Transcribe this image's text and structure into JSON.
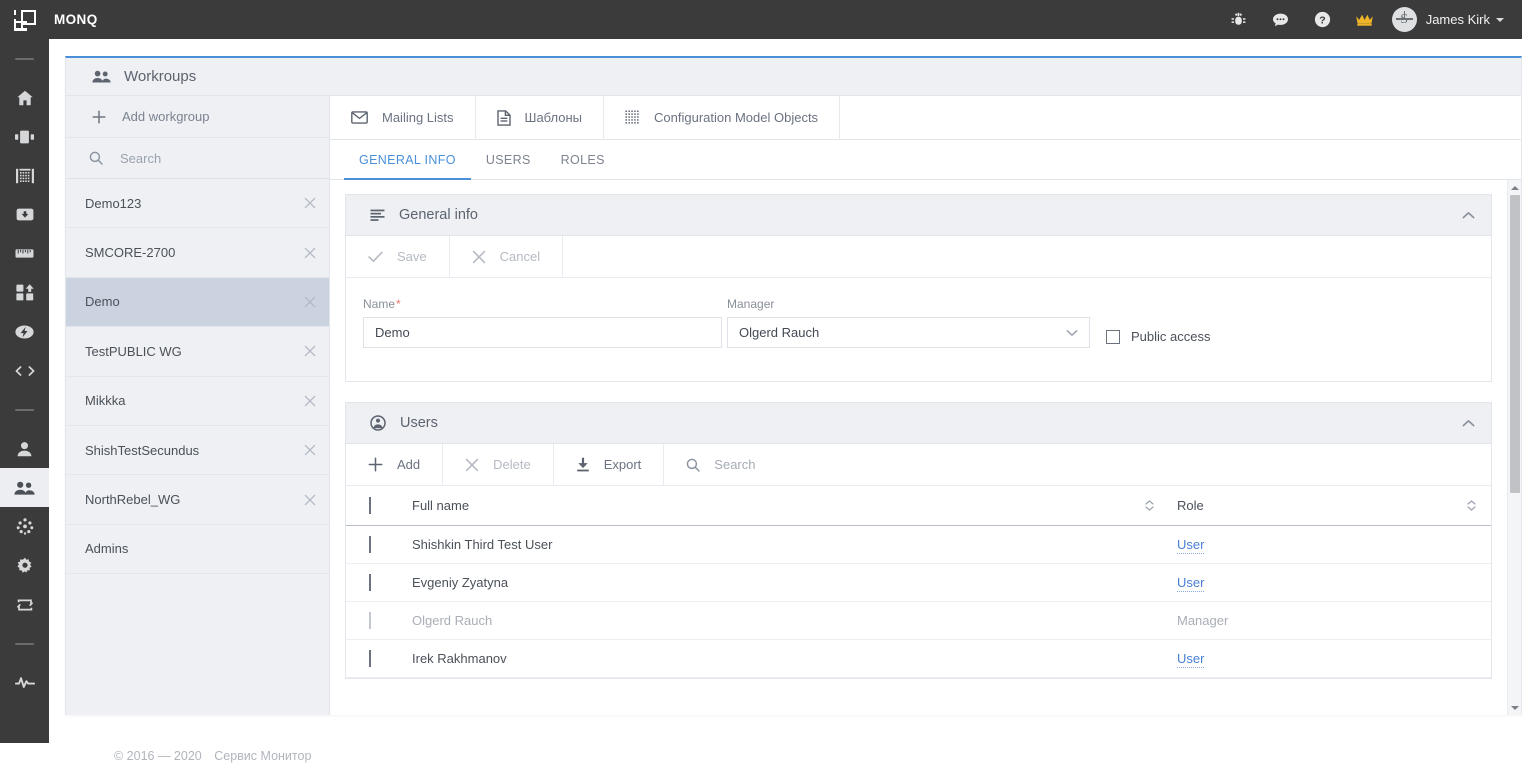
{
  "app": {
    "brand": "MONQ",
    "logo_icon": "monq-logo-icon"
  },
  "topbar": {
    "icons": [
      {
        "name": "bug-icon",
        "label": "Bug report"
      },
      {
        "name": "chat-icon",
        "label": "Chat"
      },
      {
        "name": "help-icon",
        "label": "Help"
      },
      {
        "name": "crown-icon",
        "label": "Premium",
        "color": "#f0b429"
      }
    ],
    "user": {
      "name": "James Kirk",
      "avatar_icon": "user-avatar-icon",
      "caret_icon": "chevron-down-icon"
    }
  },
  "rail": {
    "items": [
      {
        "name": "divider-top",
        "icon": "divider",
        "type": "divider"
      },
      {
        "name": "home",
        "icon": "home-icon",
        "type": "item"
      },
      {
        "name": "panels",
        "icon": "panels-icon",
        "type": "item"
      },
      {
        "name": "grid-table",
        "icon": "grid-table-icon",
        "type": "item"
      },
      {
        "name": "archive",
        "icon": "archive-down-icon",
        "type": "item"
      },
      {
        "name": "ruler",
        "icon": "ruler-icon",
        "type": "item"
      },
      {
        "name": "blocks",
        "icon": "blocks-icon",
        "type": "item"
      },
      {
        "name": "automation",
        "icon": "bolt-icon",
        "type": "item"
      },
      {
        "name": "code",
        "icon": "code-icon",
        "type": "item"
      },
      {
        "name": "divider-mid",
        "icon": "divider",
        "type": "divider"
      },
      {
        "name": "user",
        "icon": "user-icon",
        "type": "item"
      },
      {
        "name": "groups",
        "icon": "groups-icon",
        "type": "item",
        "active": true
      },
      {
        "name": "cluster",
        "icon": "cluster-icon",
        "type": "item"
      },
      {
        "name": "settings",
        "icon": "gear-icon",
        "type": "item"
      },
      {
        "name": "sync",
        "icon": "sync-icon",
        "type": "item"
      },
      {
        "name": "divider-bottom",
        "icon": "divider",
        "type": "divider"
      },
      {
        "name": "pulse",
        "icon": "pulse-icon",
        "type": "item"
      }
    ]
  },
  "page": {
    "title": "Workroups",
    "title_icon": "groups-icon"
  },
  "toolbar": {
    "add_workgroup": {
      "label": "Add workgroup",
      "icon": "plus-icon"
    },
    "buttons": [
      {
        "label": "Mailing Lists",
        "icon": "envelope-icon"
      },
      {
        "label": "Шаблоны",
        "icon": "document-icon"
      },
      {
        "label": "Configuration Model Objects",
        "icon": "dot-grid-icon"
      }
    ]
  },
  "workgroups": {
    "search_placeholder": "Search",
    "search_icon": "search-icon",
    "close_icon": "close-icon",
    "items": [
      {
        "label": "Demo123",
        "closable": true,
        "selected": false
      },
      {
        "label": "SMCORE-2700",
        "closable": true,
        "selected": false
      },
      {
        "label": "Demo",
        "closable": true,
        "selected": true
      },
      {
        "label": "TestPUBLIC WG",
        "closable": true,
        "selected": false
      },
      {
        "label": "Mikkka",
        "closable": true,
        "selected": false
      },
      {
        "label": "ShishTestSecundus",
        "closable": true,
        "selected": false
      },
      {
        "label": "NorthRebel_WG",
        "closable": true,
        "selected": false
      },
      {
        "label": "Admins",
        "closable": false,
        "selected": false
      }
    ]
  },
  "tabs": [
    {
      "label": "GENERAL INFO",
      "active": true
    },
    {
      "label": "USERS",
      "active": false
    },
    {
      "label": "ROLES",
      "active": false
    }
  ],
  "general_info": {
    "title": "General info",
    "title_icon": "list-lines-icon",
    "collapse_icon": "chevron-up-icon",
    "save": {
      "label": "Save",
      "icon": "check-icon",
      "disabled": true
    },
    "cancel": {
      "label": "Cancel",
      "icon": "close-icon",
      "disabled": true
    },
    "name_field": {
      "label": "Name",
      "required_mark": "*",
      "value": "Demo"
    },
    "manager_field": {
      "label": "Manager",
      "value": "Olgerd Rauch",
      "chevron_icon": "chevron-down-icon"
    },
    "public_access": {
      "label": "Public access",
      "checked": false
    }
  },
  "users_panel": {
    "title": "Users",
    "title_icon": "user-circle-icon",
    "collapse_icon": "chevron-up-icon",
    "tools": {
      "add": {
        "label": "Add",
        "icon": "plus-icon",
        "disabled": false
      },
      "delete": {
        "label": "Delete",
        "icon": "close-icon",
        "disabled": true
      },
      "export": {
        "label": "Export",
        "icon": "download-icon",
        "disabled": false
      },
      "search_placeholder": "Search",
      "search_icon": "search-icon"
    },
    "columns": [
      {
        "label": "Full name",
        "sortable": true,
        "sort_icon": "sort-updown-icon"
      },
      {
        "label": "Role",
        "sortable": true,
        "sort_icon": "sort-updown-icon"
      }
    ],
    "rows": [
      {
        "full_name": "Shishkin Third Test User",
        "role": "User",
        "role_is_link": true,
        "disabled": false,
        "checked": false
      },
      {
        "full_name": "Evgeniy Zyatyna",
        "role": "User",
        "role_is_link": true,
        "disabled": false,
        "checked": false
      },
      {
        "full_name": "Olgerd Rauch",
        "role": "Manager",
        "role_is_link": false,
        "disabled": true,
        "checked": false
      },
      {
        "full_name": "Irek Rakhmanov",
        "role": "User",
        "role_is_link": true,
        "disabled": false,
        "checked": false
      }
    ]
  },
  "scrollbar": {
    "up_arrow_icon": "triangle-up-icon",
    "down_arrow_icon": "triangle-down-icon"
  },
  "footer": {
    "copyright": "© 2016 — 2020",
    "product": "Сервис Монитор"
  },
  "colors": {
    "accent": "#4a90d9",
    "topbar_bg": "#3b3b3b",
    "panel_bg": "#eef0f3",
    "selected_row": "#ccd3e0",
    "crown": "#f0b429",
    "required": "#f07a6a"
  }
}
